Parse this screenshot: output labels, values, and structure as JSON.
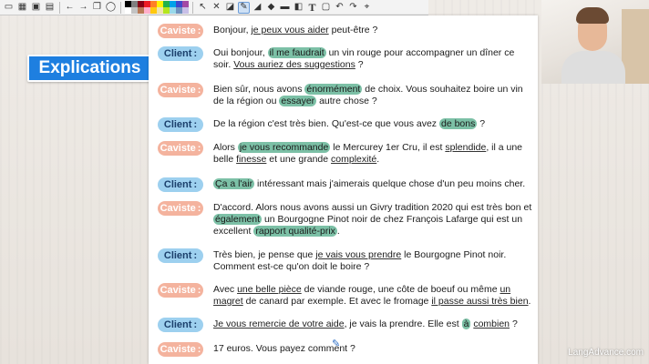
{
  "toolbar": {
    "icons": [
      "folder-icon",
      "image-icon",
      "picture-icon",
      "save-icon",
      "undo-arrow-icon",
      "redo-arrow-icon",
      "copy-icon",
      "circle-icon",
      "select-pointer-icon",
      "tools-icon",
      "eraser-icon",
      "pen-icon",
      "marker-icon",
      "bucket-icon",
      "highlighter-icon",
      "stamp-icon",
      "text-icon",
      "shape-icon",
      "undo-icon",
      "redo-icon",
      "cursor-icon"
    ],
    "swatch_colors": [
      "#000000",
      "#7f7f7f",
      "#880015",
      "#ed1c24",
      "#ff7f27",
      "#fff200",
      "#22b14c",
      "#00a2e8",
      "#3f48cc",
      "#a349a4",
      "#ffffff",
      "#c3c3c3",
      "#b97a57",
      "#ffaec9",
      "#ffc90e",
      "#efe4b0",
      "#b5e61d",
      "#99d9ea",
      "#7092be",
      "#c8bfe7"
    ],
    "text_tool_label": "T"
  },
  "title_badge": "Explications",
  "speakers": {
    "caviste": "Caviste",
    "client": "Client"
  },
  "colors": {
    "caviste_tag": "#f4b39e",
    "client_tag": "#9dd0ef",
    "highlight": "#7cc0a6",
    "badge": "#1e7fe0"
  },
  "lines": [
    {
      "speaker": "caviste",
      "segments": [
        {
          "t": "Bonjour, "
        },
        {
          "t": "je peux vous aider",
          "u": true
        },
        {
          "t": " peut-être ?"
        }
      ]
    },
    {
      "speaker": "client",
      "segments": [
        {
          "t": "Oui bonjour, "
        },
        {
          "t": "il me faudrait",
          "h": true
        },
        {
          "t": " un vin rouge pour accompagner un dîner ce soir. "
        },
        {
          "t": "Vous auriez des suggestions",
          "u": true
        },
        {
          "t": " ?"
        }
      ]
    },
    {
      "speaker": "caviste",
      "segments": [
        {
          "t": "Bien sûr, nous avons "
        },
        {
          "t": "énormément",
          "h": true
        },
        {
          "t": " de choix. Vous souhaitez boire un vin de la région ou "
        },
        {
          "t": "essayer",
          "h": true
        },
        {
          "t": " autre chose ?"
        }
      ]
    },
    {
      "speaker": "client",
      "segments": [
        {
          "t": "De la région c'est très bien. Qu'est-ce que vous avez "
        },
        {
          "t": "de bons",
          "h": true
        },
        {
          "t": " ?"
        }
      ]
    },
    {
      "speaker": "caviste",
      "segments": [
        {
          "t": "Alors "
        },
        {
          "t": "je vous recommande",
          "h": true
        },
        {
          "t": " le Mercurey 1er Cru, il est "
        },
        {
          "t": "splendide",
          "u": true
        },
        {
          "t": ", il a une belle "
        },
        {
          "t": "finesse",
          "u": true
        },
        {
          "t": " et une grande "
        },
        {
          "t": "complexité",
          "u": true
        },
        {
          "t": "."
        }
      ]
    },
    {
      "speaker": "client",
      "segments": [
        {
          "t": "Ça a l'air",
          "h": true
        },
        {
          "t": " intéressant mais j'aimerais quelque chose d'un peu moins cher."
        }
      ]
    },
    {
      "speaker": "caviste",
      "segments": [
        {
          "t": "D'accord. Alors nous avons aussi un Givry tradition 2020 qui est très bon et "
        },
        {
          "t": "également",
          "h": true
        },
        {
          "t": " un Bourgogne Pinot noir de chez François Lafarge qui est un excellent "
        },
        {
          "t": "rapport qualité-prix",
          "h": true
        },
        {
          "t": "."
        }
      ]
    },
    {
      "speaker": "client",
      "segments": [
        {
          "t": "Très bien, je pense que "
        },
        {
          "t": "je vais vous prendre",
          "u": true
        },
        {
          "t": " le Bourgogne Pinot noir. Comment est-ce qu'on doit le boire ?"
        }
      ]
    },
    {
      "speaker": "caviste",
      "segments": [
        {
          "t": "Avec "
        },
        {
          "t": "une belle pièce",
          "u": true
        },
        {
          "t": " de viande rouge, une côte de boeuf ou même "
        },
        {
          "t": "un magret",
          "u": true
        },
        {
          "t": " de canard par exemple. Et avec le fromage "
        },
        {
          "t": "il passe aussi très bien",
          "u": true
        },
        {
          "t": "."
        }
      ]
    },
    {
      "speaker": "client",
      "segments": [
        {
          "t": "Je vous remercie de votre aide",
          "u": true
        },
        {
          "t": ", je vais la prendre. Elle est "
        },
        {
          "t": "à",
          "h": true
        },
        {
          "t": " "
        },
        {
          "t": "combien",
          "u": true
        },
        {
          "t": " ?"
        }
      ]
    },
    {
      "speaker": "caviste",
      "segments": [
        {
          "t": "17 euros. Vous payez comment ?"
        }
      ]
    }
  ],
  "watermark": "LangAdvance.com"
}
